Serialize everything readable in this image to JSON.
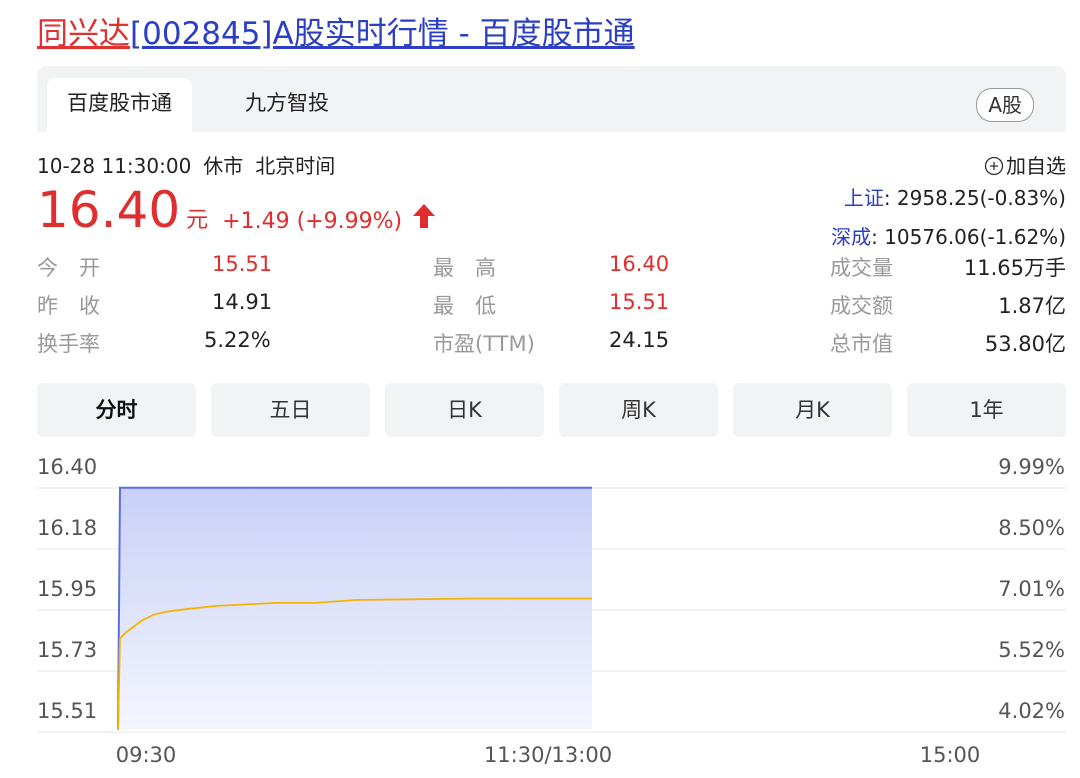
{
  "title": {
    "stock_name": "同兴达",
    "rest": "[002845]A股实时行情 - 百度股市通"
  },
  "tabs": [
    {
      "label": "百度股市通"
    },
    {
      "label": "九方智投"
    }
  ],
  "market_tag": "A股",
  "meta": {
    "datetime": "10-28 11:30:00",
    "status": "休市",
    "timezone": "北京时间"
  },
  "add_watch": "加自选",
  "indices": [
    {
      "name": "上证",
      "value": ": 2958.25(-0.83%)"
    },
    {
      "name": "深成",
      "value": ": 10576.06(-1.62%)"
    }
  ],
  "price": {
    "current": "16.40",
    "unit": "元",
    "change": "+1.49 (+9.99%)"
  },
  "stats": {
    "open": {
      "label": "今　开",
      "value": "15.51"
    },
    "prev_close": {
      "label": "昨　收",
      "value": "14.91"
    },
    "turnover_rate": {
      "label": "换手率",
      "value": "5.22%"
    },
    "high": {
      "label": "最　高",
      "value": "16.40"
    },
    "low": {
      "label": "最　低",
      "value": "15.51"
    },
    "pe": {
      "label": "市盈(TTM)",
      "value": "24.15"
    },
    "volume": {
      "label": "成交量",
      "value": "11.65万手"
    },
    "amount": {
      "label": "成交额",
      "value": "1.87亿"
    },
    "market_cap": {
      "label": "总市值",
      "value": "53.80亿"
    }
  },
  "periods": [
    {
      "label": "分时"
    },
    {
      "label": "五日"
    },
    {
      "label": "日K"
    },
    {
      "label": "周K"
    },
    {
      "label": "月K"
    },
    {
      "label": "1年"
    }
  ],
  "colors": {
    "up": "#e02d2d",
    "link": "#2a3fc4",
    "price_line": "#5b6ee1",
    "avg_line": "#f5b400"
  },
  "chart_data": {
    "type": "line",
    "y_ticks": [
      "16.40",
      "16.18",
      "15.95",
      "15.73",
      "15.51"
    ],
    "y_right_ticks": [
      "9.99%",
      "8.50%",
      "7.01%",
      "5.52%",
      "4.02%"
    ],
    "x_ticks": [
      "09:30",
      "11:30/13:00",
      "15:00"
    ],
    "ylim": [
      15.51,
      16.4
    ],
    "session_minutes": 240,
    "series": [
      {
        "values": [
          [
            0,
            15.51
          ],
          [
            0.5,
            16.33
          ],
          [
            120,
            16.33
          ]
        ]
      },
      {
        "values": [
          [
            0,
            15.51
          ],
          [
            0.5,
            15.82
          ],
          [
            2,
            15.84
          ],
          [
            4,
            15.86
          ],
          [
            6,
            15.88
          ],
          [
            9,
            15.9
          ],
          [
            12,
            15.91
          ],
          [
            18,
            15.92
          ],
          [
            25,
            15.93
          ],
          [
            40,
            15.94
          ],
          [
            50,
            15.94
          ],
          [
            60,
            15.95
          ],
          [
            90,
            15.955
          ],
          [
            120,
            15.955
          ]
        ]
      }
    ]
  }
}
